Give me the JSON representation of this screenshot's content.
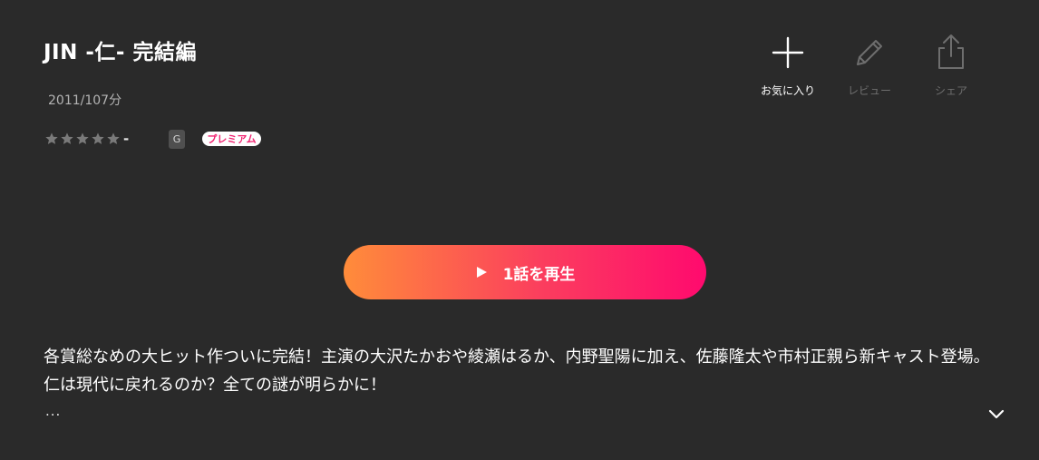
{
  "title": "JIN -仁- 完結編",
  "meta": {
    "year_duration": "2011/107分"
  },
  "rating": {
    "stars": 0,
    "max_stars": 5,
    "value": "-"
  },
  "badges": {
    "grade": "G",
    "premium": "プレミアム"
  },
  "actions": [
    {
      "label": "お気に入り",
      "icon": "plus-icon",
      "state": "active"
    },
    {
      "label": "レビュー",
      "icon": "pencil-icon",
      "state": "disabled"
    },
    {
      "label": "シェア",
      "icon": "share-icon",
      "state": "disabled"
    }
  ],
  "play": {
    "label": "1話を再生",
    "icon": "play-icon"
  },
  "description": "各賞総なめの大ヒット作ついに完結！主演の大沢たかおや綾瀬はるか、内野聖陽に加え、佐藤隆太や市村正親ら新キャスト登場。仁は現代に戻れるのか？全ての謎が明らかに！",
  "ellipsis": "...",
  "colors": {
    "background": "#2a2a2a",
    "play_gradient_start": "#ff8c3a",
    "play_gradient_end": "#ff0a6e",
    "premium_text": "#f0216f",
    "star_empty": "#7a7a7a",
    "disabled": "#6e6e6e"
  }
}
